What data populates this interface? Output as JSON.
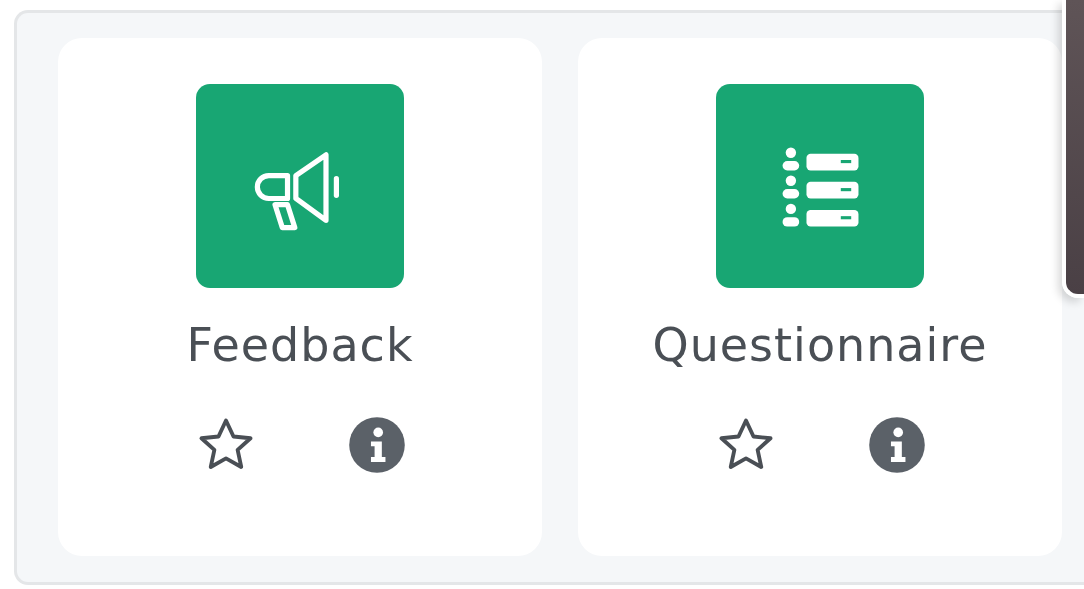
{
  "modules": [
    {
      "name": "Feedback",
      "kind": "megaphone",
      "starred": false
    },
    {
      "name": "Questionnaire",
      "kind": "list",
      "starred": false
    }
  ]
}
